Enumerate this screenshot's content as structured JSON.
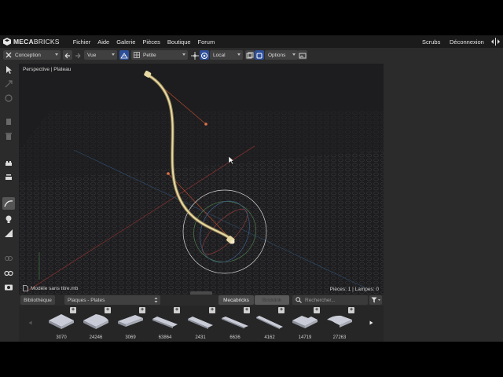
{
  "menubar": {
    "logo_text_bold": "MECA",
    "logo_text_rest": "BRICKS",
    "items": [
      "Fichier",
      "Aide",
      "Galerie",
      "Pièces",
      "Boutique",
      "Forum"
    ],
    "scrubs": "Scrubs",
    "logout": "Déconnexion"
  },
  "toolbar": {
    "mode": "Conception",
    "view": "Vue",
    "grid": "Petite",
    "space": "Local",
    "options": "Options"
  },
  "viewport": {
    "label": "Perspective | Plateau",
    "file_name": "Modèle sans titre.mb",
    "stats": "Pièces: 1 | Lampes: 0"
  },
  "library": {
    "tab": "Bibliothèque",
    "category": "Plaques - Plates",
    "source_active": "Mecabricks",
    "source_inactive": "Bricklink",
    "search_placeholder": "Rechercher...",
    "parts": [
      {
        "id": "3070",
        "shape": "tile-square"
      },
      {
        "id": "24246",
        "shape": "tile-round-corner"
      },
      {
        "id": "3069",
        "shape": "tile-1x2"
      },
      {
        "id": "63864",
        "shape": "tile-1x3"
      },
      {
        "id": "2431",
        "shape": "tile-1x4"
      },
      {
        "id": "6636",
        "shape": "tile-1x6"
      },
      {
        "id": "4162",
        "shape": "tile-1x8"
      },
      {
        "id": "14719",
        "shape": "tile-corner"
      },
      {
        "id": "27263",
        "shape": "tile-round-corner-2"
      }
    ]
  },
  "colors": {
    "accent": "#2d4f9a",
    "flex_tube": "#d9c58c",
    "handle": "#e0734a"
  }
}
